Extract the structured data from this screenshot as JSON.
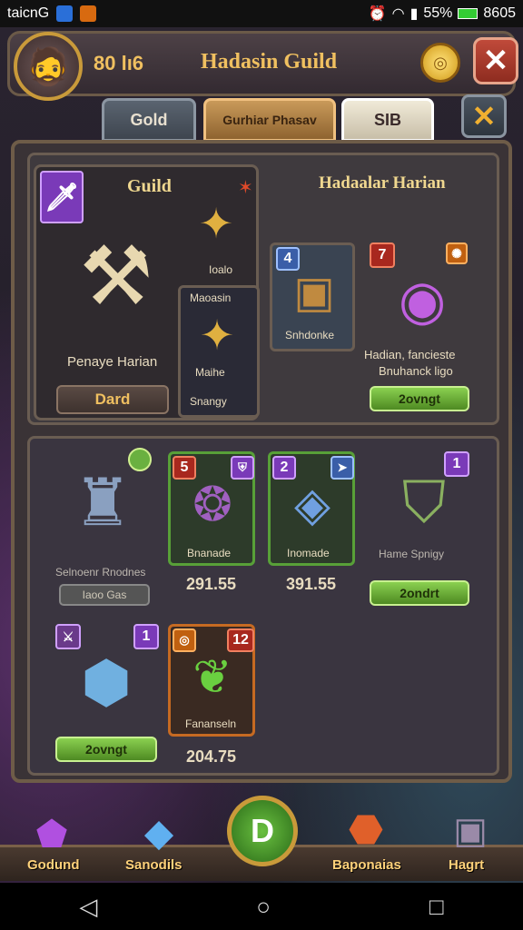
{
  "status": {
    "carrier": "taicnG",
    "battery": "55%",
    "time": "8605"
  },
  "header": {
    "level_text": "80 lı6",
    "title": "Hadasin Guild"
  },
  "tabs": [
    {
      "label": "Gold"
    },
    {
      "label": "Gurhiar Phasav"
    },
    {
      "label": "SIB"
    }
  ],
  "guild_panel": {
    "tag": "Guild",
    "name": "Penaye Harian",
    "button": "Dard",
    "item1_label": "Ioalo",
    "item2_top": "Maoasin",
    "item2_name": "Maihe",
    "item2_sub": "Snangy"
  },
  "right_panel": {
    "title": "Hadaalar Harian",
    "card1": {
      "badge": "4",
      "label": "Snhdonke"
    },
    "card2": {
      "badge": "7",
      "label_line1": "Hadian, fancieste",
      "label_line2": "Bnuhanck ligo",
      "button": "2ovngt"
    }
  },
  "shop": [
    {
      "label": "Selnoenr Rnodnes",
      "button": "Iaoo Gas"
    },
    {
      "badge": "5",
      "label": "Bnanade",
      "price": "291.55"
    },
    {
      "badge": "2",
      "label": "Inomade",
      "price": "391.55"
    },
    {
      "badge": "1",
      "label": "Hame Spnigy",
      "button": "2ondrt"
    },
    {
      "badge": "1",
      "button": "2ovngt"
    },
    {
      "badge": "12",
      "label": "Fananseln",
      "price": "204.75"
    }
  ],
  "nav": [
    {
      "label": "Godund"
    },
    {
      "label": "Sanodils"
    },
    {
      "label": "Baponaias"
    },
    {
      "label": "Hagrt"
    }
  ],
  "colors": {
    "accent": "#f0c060",
    "green": "#58a038"
  }
}
